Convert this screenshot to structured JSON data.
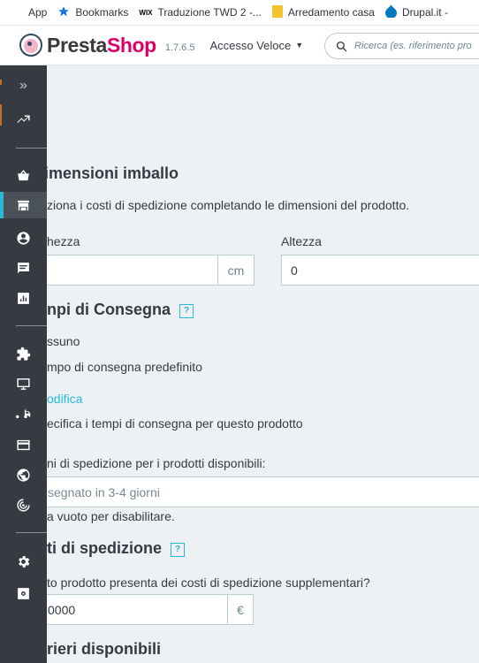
{
  "bookmarks": {
    "items": [
      {
        "label": "App",
        "icon": "apps-grid-icon"
      },
      {
        "label": "Bookmarks",
        "icon": "star-icon"
      },
      {
        "label": "Traduzione TWD 2 -...",
        "icon": "wix-icon"
      },
      {
        "label": "Arredamento casa",
        "icon": "folder-icon"
      },
      {
        "label": "Drupal.it -",
        "icon": "drupal-icon"
      }
    ],
    "wix_text": "WIX"
  },
  "header": {
    "logo_part1": "Presta",
    "logo_part2": "Shop",
    "version": "1.7.6.5",
    "quick_access": "Accesso Veloce",
    "search_placeholder": "Ricerca (es. riferimento pro"
  },
  "sidebar": {
    "collapse_icon": "»",
    "items": [
      "stats",
      "orders",
      "catalog",
      "customers",
      "messages",
      "reports",
      "modules",
      "design",
      "shipping",
      "payment",
      "international",
      "marketing",
      "settings",
      "advanced-settings"
    ]
  },
  "package": {
    "title": "imensioni imballo",
    "description": "ziona i costi di spedizione completando le dimensioni del prodotto.",
    "width_label": "hezza",
    "height_label": "Altezza",
    "width_unit": "cm",
    "height_value": "0"
  },
  "delivery": {
    "title": "npi di Consegna",
    "help": "?",
    "option_none": "ssuno",
    "option_default": "mpo di consegna predefinito",
    "edit_link": "odifica",
    "option_specific": "ecifica i tempi di consegna per questo prodotto",
    "available_label": "ni di spedizione per i prodotti disponibili:",
    "available_placeholder": "segnato in 3-4 giorni",
    "empty_hint": "a vuoto per disabilitare."
  },
  "shipping_costs": {
    "title": "ti di spedizione",
    "help": "?",
    "question": "to prodotto presenta dei costi di spedizione supplementari?",
    "value": "0000",
    "currency": "€"
  },
  "carriers": {
    "title": "rieri disponibili"
  },
  "colors": {
    "accent": "#25b9d7",
    "sidebar": "#363a41",
    "brand_pink": "#df0067"
  }
}
